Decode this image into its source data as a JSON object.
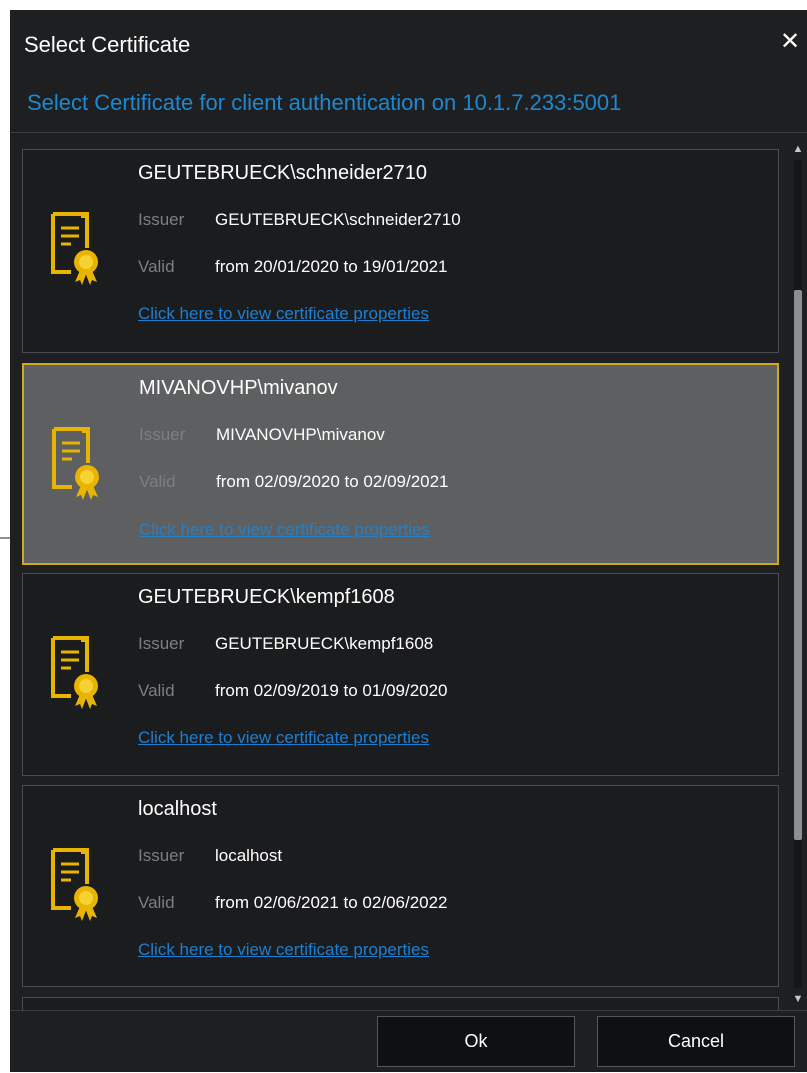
{
  "dialog": {
    "title": "Select Certificate",
    "close_glyph": "✕",
    "subtitle": "Select Certificate for client authentication on 10.1.7.233:5001"
  },
  "labels": {
    "issuer": "Issuer",
    "valid": "Valid"
  },
  "certificates": [
    {
      "name": "GEUTEBRUECK\\schneider2710",
      "issuer": "GEUTEBRUECK\\schneider2710",
      "valid": "from 20/01/2020 to 19/01/2021",
      "link": "Click here to view certificate properties",
      "selected": false
    },
    {
      "name": "MIVANOVHP\\mivanov",
      "issuer": "MIVANOVHP\\mivanov",
      "valid": "from 02/09/2020 to 02/09/2021",
      "link": "Click here to view certificate properties",
      "selected": true
    },
    {
      "name": "GEUTEBRUECK\\kempf1608",
      "issuer": "GEUTEBRUECK\\kempf1608",
      "valid": "from 02/09/2019 to 01/09/2020",
      "link": "Click here to view certificate properties",
      "selected": false
    },
    {
      "name": "localhost",
      "issuer": "localhost",
      "valid": "from 02/06/2021 to 02/06/2022",
      "link": "Click here to view certificate properties",
      "selected": false
    }
  ],
  "icons": {
    "certificate": "certificate-icon",
    "close": "close-icon",
    "scroll_up": "scroll-up-arrow-icon",
    "scroll_down": "scroll-down-arrow-icon"
  },
  "buttons": {
    "ok": "Ok",
    "cancel": "Cancel"
  },
  "colors": {
    "accent": "#1e88cf",
    "selection_border": "#d4a815",
    "icon": "#e8b400",
    "link": "#1e7fd0"
  }
}
